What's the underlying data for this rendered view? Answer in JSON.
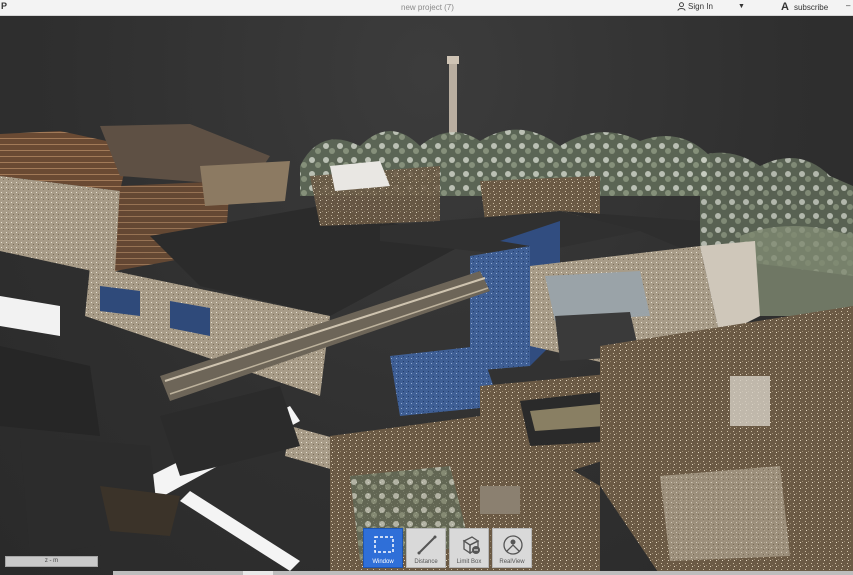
{
  "app": {
    "mark": "P",
    "title": "new project (7)",
    "sign_in_label": "Sign In",
    "subscribe_label": "subscribe",
    "autodesk_logo": "A"
  },
  "icons": {
    "user": "user-icon",
    "caret": "chevron-down-icon",
    "brand": "autodesk-logo-icon",
    "window": "window-select-icon",
    "distance": "distance-measure-icon",
    "limitbox": "limit-box-icon",
    "realview": "realview-icon"
  },
  "toolbar": {
    "tools": [
      {
        "label": "Window",
        "active": true
      },
      {
        "label": "Distance",
        "active": false
      },
      {
        "label": "Limit Box",
        "active": false
      },
      {
        "label": "RealView",
        "active": false
      }
    ]
  },
  "status": {
    "coordinate_readout": "z - m"
  },
  "colors": {
    "viewport_bg": "#2f2f2f",
    "accent_active": "#2f6fd8",
    "titlebar_bg": "#f3f3f3"
  }
}
